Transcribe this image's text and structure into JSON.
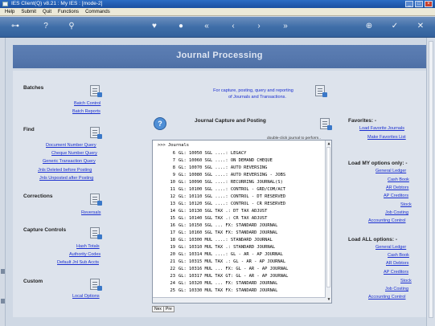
{
  "window": {
    "title": "IES Client(Q) v8.21 : My IES :       [mode-2]"
  },
  "menu": [
    "Help",
    "Submit",
    "Quit",
    "Functions",
    "Commands"
  ],
  "toolbar_icons": [
    "key-icon",
    "info-icon",
    "search-icon",
    "heart-icon",
    "circle-icon",
    "rewind-icon",
    "back-icon",
    "forward-icon",
    "fast-forward-icon",
    "plus-icon",
    "check-icon",
    "close-icon"
  ],
  "banner": {
    "title": "Journal Processing"
  },
  "left": {
    "batches": {
      "title": "Batches",
      "links": [
        "Batch Control",
        "Batch Reports"
      ]
    },
    "find": {
      "title": "Find",
      "links": [
        "Document Number Query",
        "Cheque Number Query",
        "Generic Transaction Query",
        "Jnls Deleted before Posting",
        "Jnls Unposted after Posting"
      ]
    },
    "corrections": {
      "title": "Corrections",
      "links": [
        "Reversals"
      ]
    },
    "capture": {
      "title": "Capture Controls",
      "links": [
        "Hash Totals",
        "Authority Codes",
        "Default Jnl Sub Accts"
      ]
    },
    "custom": {
      "title": "Custom",
      "links": [
        "Local Options"
      ]
    }
  },
  "center": {
    "info_line1": "For capture, posting, query and reporting",
    "info_line2": "of Journals and Transactions.",
    "capture_title": "Journal Capture and Posting",
    "hint": "double-click journal to perform..",
    "list_header": ">>> Journals",
    "journals": [
      {
        "num": "6",
        "text": "GL: 10050 SGL ....: LEGACY"
      },
      {
        "num": "7",
        "text": "GL: 10060 SGL ....: ON DEMAND CHEQUE"
      },
      {
        "num": "8",
        "text": "GL: 10070 SGL ....: AUTO REVERSING"
      },
      {
        "num": "9",
        "text": "GL: 10080 SGL ....: AUTO REVERSING - JOBS"
      },
      {
        "num": "10",
        "text": "GL: 10090 SGL ....: RECURRING JOURNAL(S)"
      },
      {
        "num": "11",
        "text": "GL: 10100 SGL ....: CONTROL - GRD/COM/ACT"
      },
      {
        "num": "12",
        "text": "GL: 10110 SGL ....: CONTROL - DT RESERVED"
      },
      {
        "num": "13",
        "text": "GL: 10120 SGL ....: CONTROL - CR RESERVED"
      },
      {
        "num": "14",
        "text": "GL: 10130 SGL TAX .: DT TAX ADJUST"
      },
      {
        "num": "15",
        "text": "GL: 10140 SGL TAX .: CR TAX ADJUST"
      },
      {
        "num": "16",
        "text": "GL: 10150 SGL ... FX: STANDARD JOURNAL"
      },
      {
        "num": "17",
        "text": "GL: 10160 SGL TAX FX: STANDARD JOURNAL"
      },
      {
        "num": "18",
        "text": "GL: 10300 MUL ....: STANDARD JOURNAL"
      },
      {
        "num": "19",
        "text": "GL: 10310 MUL TAX .: STANDARD JOURNAL"
      },
      {
        "num": "20",
        "text": "GL: 10314 MUL ....: GL - AR - AP JOURNAL"
      },
      {
        "num": "21",
        "text": "GL: 10315 MUL TAX .: GL - AR - AP JOURNAL"
      },
      {
        "num": "22",
        "text": "GL: 10316 MUL ... FX: GL - AR - AP JOURNAL"
      },
      {
        "num": "23",
        "text": "GL: 10317 MUL TAX GT: GL - AR - AP JOURNAL"
      },
      {
        "num": "24",
        "text": "GL: 10320 MUL ... FX: STANDARD JOURNAL"
      },
      {
        "num": "25",
        "text": "GL: 10330 MUL TAX FX: STANDARD JOURNAL"
      }
    ],
    "nav": {
      "next": "Nex",
      "prev": "Pre"
    }
  },
  "right": {
    "favorites": {
      "title": "Favorites: -",
      "links": [
        "Load Favorite Journals",
        "Make Favorites List"
      ]
    },
    "my_options": {
      "title": "Load MY options only: -",
      "links": [
        "General Ledger",
        "Cash Book",
        "AR Debtors",
        "AP Creditors",
        "Stock",
        "Job Costing",
        "Accounting Control"
      ]
    },
    "all_options": {
      "title": "Load ALL options: -",
      "links": [
        "General Ledger",
        "Cash Book",
        "AR Debtors",
        "AP Creditors",
        "Stock",
        "Job Costing",
        "Accounting Control"
      ]
    }
  }
}
